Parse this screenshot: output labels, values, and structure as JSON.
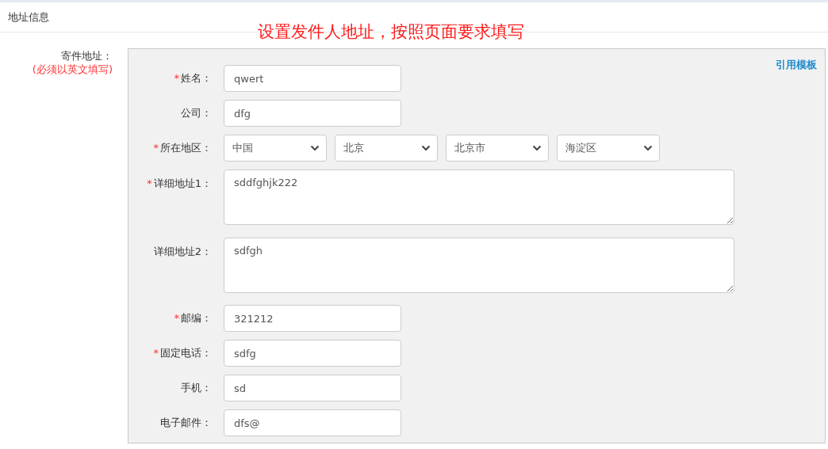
{
  "section_title": "地址信息",
  "annotation": "设置发件人地址，按照页面要求填写",
  "sender_label": "寄件地址：",
  "sender_note": "(必须以英文填写)",
  "template_link": "引用模板",
  "fields": [
    {
      "kind": "input",
      "marker": "*",
      "label": "姓名：",
      "value": "qwert"
    },
    {
      "kind": "input",
      "label": "公司：",
      "value": "dfg"
    },
    {
      "kind": "selects",
      "marker": "*",
      "label": "所在地区：",
      "values": [
        "中国",
        "北京",
        "北京市",
        "海淀区"
      ]
    },
    {
      "kind": "textarea",
      "marker": "*",
      "label": "详细地址1：",
      "value": "sddfghjk222"
    },
    {
      "kind": "textarea",
      "label": "详细地址2：",
      "value": "sdfgh"
    },
    {
      "kind": "input",
      "marker": "*",
      "label": "邮编：",
      "value": "321212"
    },
    {
      "kind": "input",
      "marker": "*",
      "label": "固定电话：",
      "value": "sdfg"
    },
    {
      "kind": "input",
      "label": "手机：",
      "value": "sd"
    },
    {
      "kind": "input",
      "label": "电子邮件：",
      "value": "dfs@"
    }
  ]
}
